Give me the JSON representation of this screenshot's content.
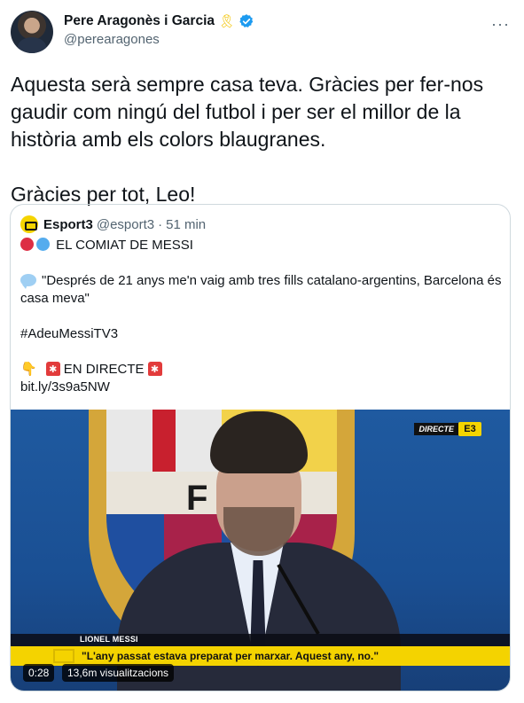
{
  "author": {
    "display_name": "Pere Aragonès i Garcia",
    "handle": "@perearagones",
    "ribbon_icon": "yellow-ribbon-icon",
    "verified_icon": "verified-badge-icon",
    "verified_color": "#1d9bf0"
  },
  "tweet": {
    "paragraph_1": "Aquesta serà sempre casa teva. Gràcies per fer-nos gaudir com ningú del futbol i per ser el millor de la història amb els colors blaugranes.",
    "paragraph_2": "Gràcies per tot, Leo!"
  },
  "quote": {
    "name": "Esport3",
    "handle": "@esport3",
    "separator": "·",
    "time": "51 min",
    "line_title": "EL COMIAT DE MESSI",
    "line_quote": "\"Després de 21 anys me'n vaig amb tres fills catalano-argentins, Barcelona és casa meva\"",
    "line_hashtag": "#AdeuMessiTV3",
    "line_live": "EN DIRECTE",
    "line_link": "bit.ly/3s9a5NW"
  },
  "video": {
    "channel_label": "DIRECTE",
    "channel_logo": "E3",
    "crest_letters": "FCB",
    "lower_third_name": "LIONEL MESSI",
    "subtitle": "\"L'any passat estava preparat per marxar. Aquest any, no.\"",
    "duration": "0:28",
    "views": "13,6m visualitzacions"
  },
  "colors": {
    "text_primary": "#0f1419",
    "text_secondary": "#536471",
    "border": "#cfd9de",
    "esport3_yellow": "#f5d400"
  }
}
